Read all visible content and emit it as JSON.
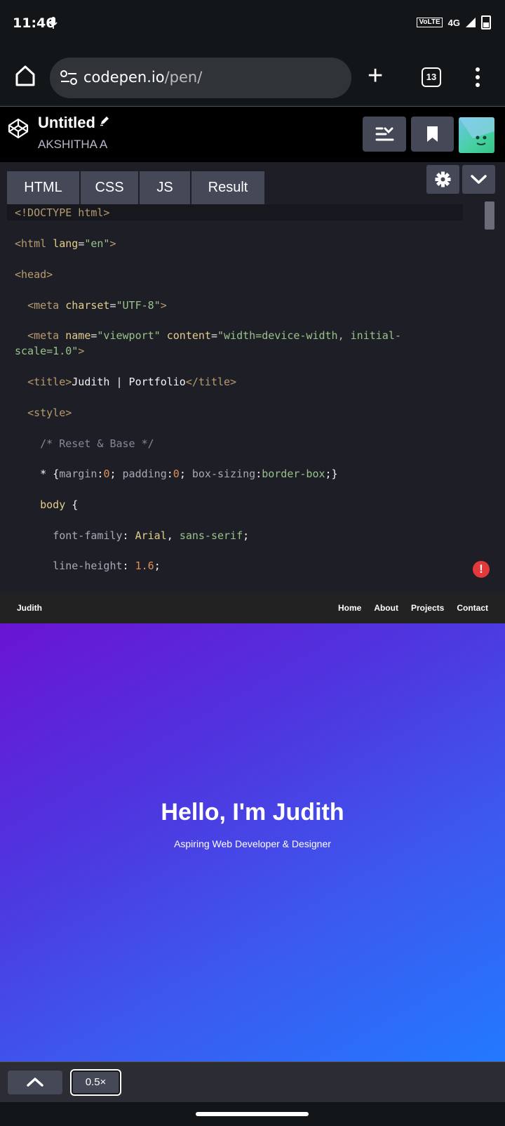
{
  "status_bar": {
    "time": "11:46",
    "network_badge": "VoLTE",
    "network": "4G"
  },
  "browser": {
    "url_domain": "codepen.io",
    "url_path": "/pen/",
    "tab_count": "13"
  },
  "codepen": {
    "title": "Untitled",
    "author": "AKSHITHA A",
    "tabs": [
      "HTML",
      "CSS",
      "JS",
      "Result"
    ]
  },
  "code_lines": [
    "<!DOCTYPE html>",
    "<html lang=\"en\">",
    "<head>",
    "  <meta charset=\"UTF-8\">",
    "  <meta name=\"viewport\" content=\"width=device-width, initial-scale=1.0\">",
    "  <title>Judith | Portfolio</title>",
    "  <style>",
    "    /* Reset & Base */",
    "    * {margin:0; padding:0; box-sizing:border-box;}",
    "    body {",
    "      font-family: Arial, sans-serif;",
    "      line-height: 1.6;"
  ],
  "result": {
    "site_logo": "Judith",
    "nav_links": [
      "Home",
      "About",
      "Projects",
      "Contact"
    ],
    "hero_title": "Hello, I'm Judith",
    "hero_subtitle": "Aspiring Web Developer & Designer"
  },
  "bottom_bar": {
    "zoom_label": "0.5×"
  },
  "colors": {
    "hero_start": "#6a14d3",
    "hero_end": "#2279ff",
    "editor_bg": "#1e1f26",
    "tab_bg": "#444857"
  }
}
